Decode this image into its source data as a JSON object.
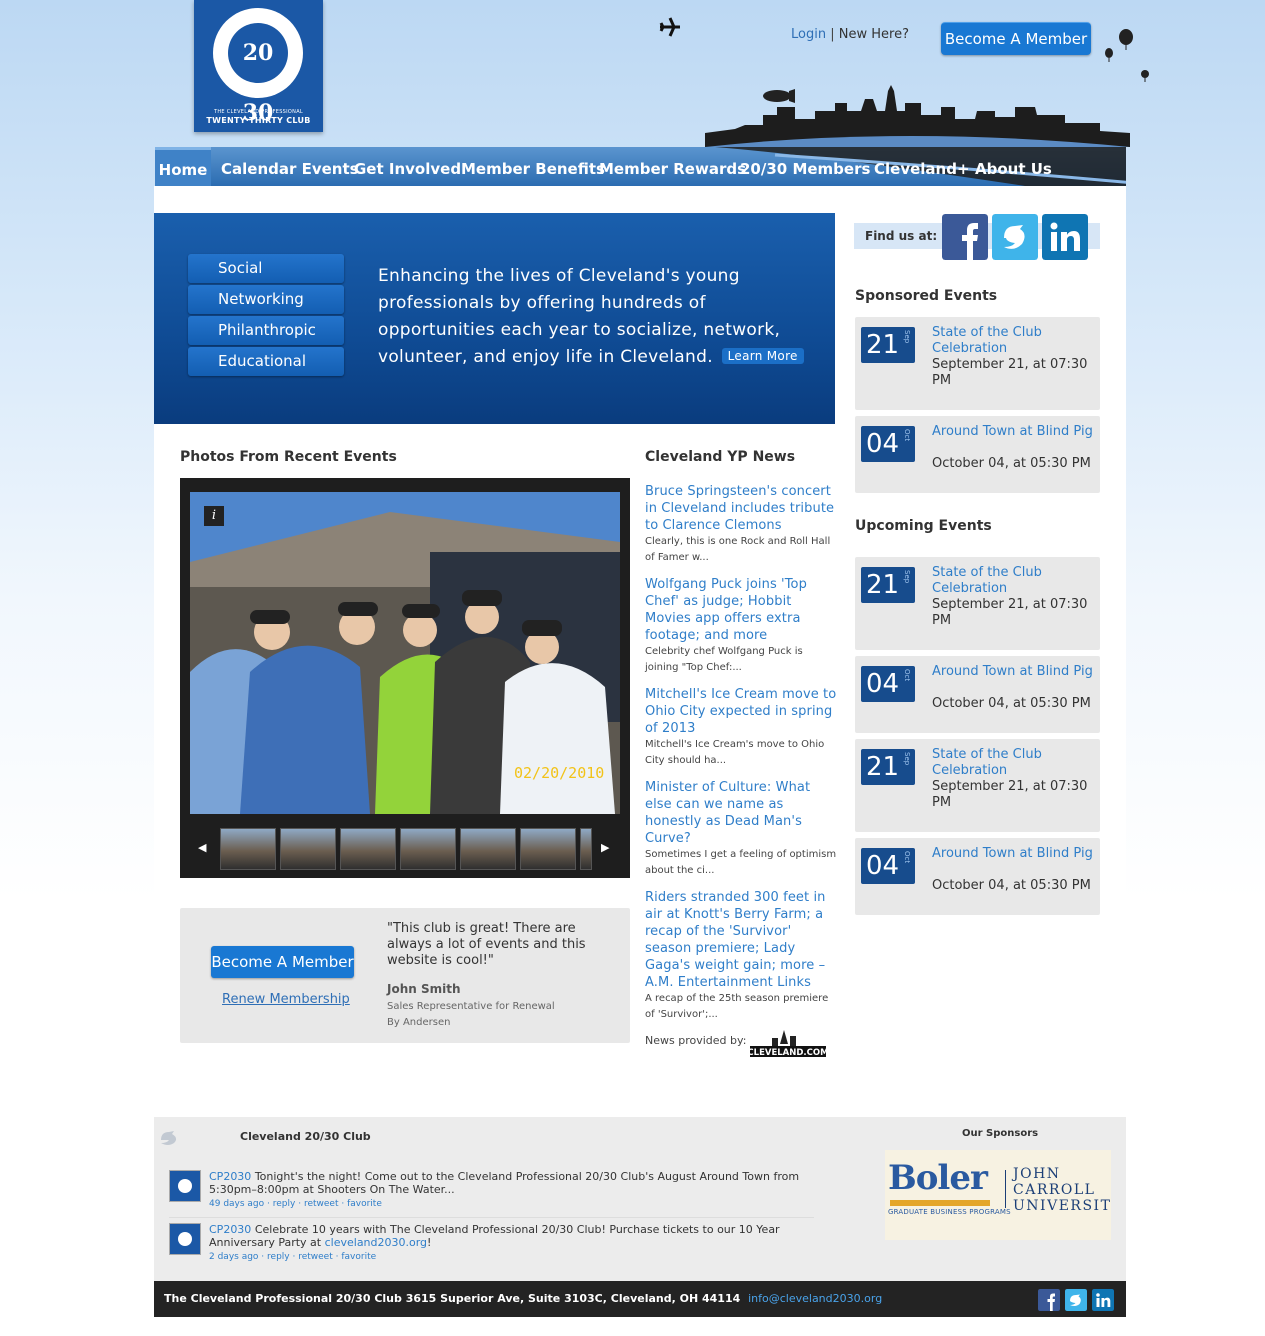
{
  "logo": {
    "monogram": "20 30",
    "small_text": "THE CLEVELAND PROFESSIONAL",
    "big_text": "TWENTY·THIRTY CLUB"
  },
  "header": {
    "login_label": "Login",
    "separator": "|",
    "new_here_label": "New Here?",
    "become_member_label": "Become A Member"
  },
  "nav": {
    "items": [
      {
        "label": "Home",
        "active": true
      },
      {
        "label": "Calendar Events"
      },
      {
        "label": "Get Involved"
      },
      {
        "label": "Member Benefits"
      },
      {
        "label": "Member Rewards"
      },
      {
        "label": "20/30 Members"
      },
      {
        "label": "Cleveland+"
      },
      {
        "label": "About Us"
      }
    ]
  },
  "hero": {
    "buttons": [
      "Social",
      "Networking",
      "Philanthropic",
      "Educational"
    ],
    "text": "Enhancing the lives of Cleveland's young professionals by offering hundreds of opportunities each year to socialize, network, volunteer, and enjoy life in Cleveland.",
    "learn_more": "Learn More"
  },
  "photos": {
    "title": "Photos From Recent Events",
    "info_icon_label": "i",
    "date_stamp": "02/20/2010",
    "thumbnail_count": 7
  },
  "member_box": {
    "become_label": "Become A Member",
    "renew_label": "Renew Membership",
    "quote": "\"This club is great! There are always a lot of events and this website is cool!\"",
    "quote_name": "John Smith",
    "quote_role": "Sales Representative for Renewal By Andersen"
  },
  "news": {
    "title": "Cleveland YP News",
    "items": [
      {
        "title": "Bruce Springsteen's concert in Cleveland includes tribute to Clarence Clemons",
        "excerpt": "Clearly, this is one Rock and Roll Hall of Famer w..."
      },
      {
        "title": "Wolfgang Puck joins 'Top Chef' as judge; Hobbit Movies app offers extra footage; and more",
        "excerpt": "Celebrity chef Wolfgang Puck is joining \"Top Chef:..."
      },
      {
        "title": "Mitchell's Ice Cream move to Ohio City expected in spring of 2013",
        "excerpt": "Mitchell's Ice Cream's move to Ohio City should ha..."
      },
      {
        "title": "Minister of Culture: What else can we name as honestly as Dead Man's Curve?",
        "excerpt": "Sometimes I get a feeling of optimism about the ci..."
      },
      {
        "title": "Riders stranded 300 feet in air at Knott's Berry Farm; a recap of the 'Survivor' season premiere; Lady Gaga's weight gain; more – A.M. Entertainment Links",
        "excerpt": "A recap of the 25th season premiere of 'Survivor';..."
      }
    ],
    "provided_by": "News provided by:",
    "provider_logo_text": "CLEVELAND.COM"
  },
  "sidebar": {
    "find_us": "Find us at:",
    "social": [
      "facebook-icon",
      "twitter-icon",
      "linkedin-icon"
    ],
    "sponsored_title": "Sponsored Events",
    "sponsored": [
      {
        "day": "21",
        "month": "Sep",
        "title": "State of the Club Celebration",
        "date": "September 21, at 07:30 PM"
      },
      {
        "day": "04",
        "month": "Oct",
        "title": "Around Town at Blind Pig",
        "date": "October 04, at 05:30 PM"
      }
    ],
    "upcoming_title": "Upcoming Events",
    "upcoming": [
      {
        "day": "21",
        "month": "Sep",
        "title": "State of the Club Celebration",
        "date": "September 21, at 07:30 PM"
      },
      {
        "day": "04",
        "month": "Oct",
        "title": "Around Town at Blind Pig",
        "date": "October 04, at 05:30 PM"
      },
      {
        "day": "21",
        "month": "Sep",
        "title": "State of the Club Celebration",
        "date": "September 21, at 07:30 PM"
      },
      {
        "day": "04",
        "month": "Oct",
        "title": "Around Town at Blind Pig",
        "date": "October 04, at 05:30 PM"
      }
    ]
  },
  "twitter": {
    "title": "Cleveland 20/30 Club",
    "tweets": [
      {
        "handle": "CP2030",
        "text": "Tonight's the night! Come out to the Cleveland Professional 20/30 Club's August Around Town from 5:30pm–8:00pm at Shooters On The Water...",
        "link": "",
        "age": "49 days ago",
        "actions": [
          "reply",
          "retweet",
          "favorite"
        ]
      },
      {
        "handle": "CP2030",
        "text": "Celebrate 10 years with The Cleveland Professional 20/30 Club! Purchase tickets to our 10 Year Anniversary Party at",
        "link": "cleveland2030.org",
        "tail": "!",
        "age": "2 days ago",
        "actions": [
          "reply",
          "retweet",
          "favorite"
        ]
      }
    ]
  },
  "sponsors": {
    "title": "Our Sponsors",
    "boler": "Boler",
    "boler_sub": "GRADUATE BUSINESS PROGRAMS",
    "jcu_line1": "JOHN",
    "jcu_line2": "CARROLL",
    "jcu_line3": "UNIVERSITY"
  },
  "footer": {
    "text": "The Cleveland Professional 20/30 Club 3615 Superior Ave, Suite 3103C, Cleveland, OH 44114",
    "email": "info@cleveland2030.org"
  },
  "colors": {
    "brand_blue": "#1b58a6",
    "link_blue": "#2f7ec9",
    "button_blue": "#1978d3",
    "footer_bg": "#232323"
  }
}
